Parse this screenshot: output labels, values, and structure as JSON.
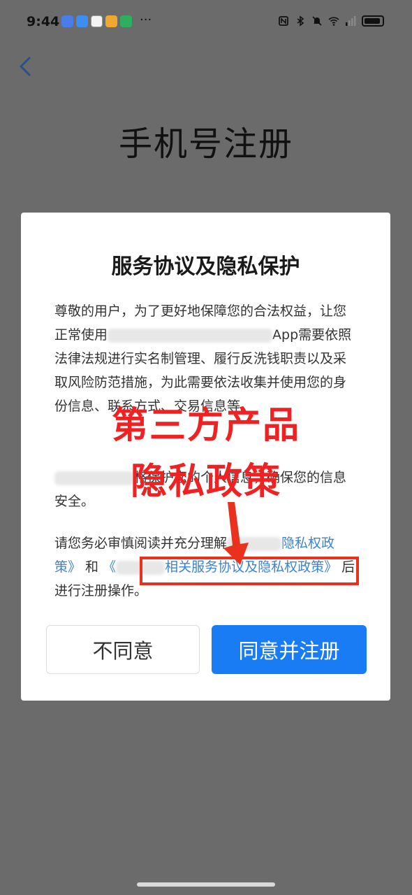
{
  "status_bar": {
    "time": "9:44",
    "more": "···",
    "app_icon_colors": [
      "#4a7de8",
      "#3d8ef0",
      "#f3f3f3",
      "#f0a830",
      "#2fae5f"
    ]
  },
  "nav": {
    "back_icon": "chevron-left-icon"
  },
  "page": {
    "title": "手机号注册"
  },
  "dialog": {
    "title": "服务协议及隐私保护",
    "p1_a": "尊敬的用户，为了更好地保障您的合法权益，让您正常使用",
    "p1_b": "App需要依照法律法规进行实名制管理、履行反洗钱职责以及采取风险防范措施，为此需要依法收集并使用您的身份信息、联系方式、交易信息等。",
    "p2_b": "格保护您的个人信息，确保您的信息安全。",
    "p3_a": "请您务必审慎阅读并充分理解",
    "p3_link1": "隐私权政策》",
    "p3_and": " 和 ",
    "p3_link2": "《",
    "p3_link2_b": "相关服务协议及隐私权政策》",
    "p3_end": " 后进行注册操作。",
    "btn_disagree": "不同意",
    "btn_agree": "同意并注册"
  },
  "annotation": {
    "line1": "第三方产品",
    "line2": "隐私政策",
    "color": "#ee2222"
  }
}
